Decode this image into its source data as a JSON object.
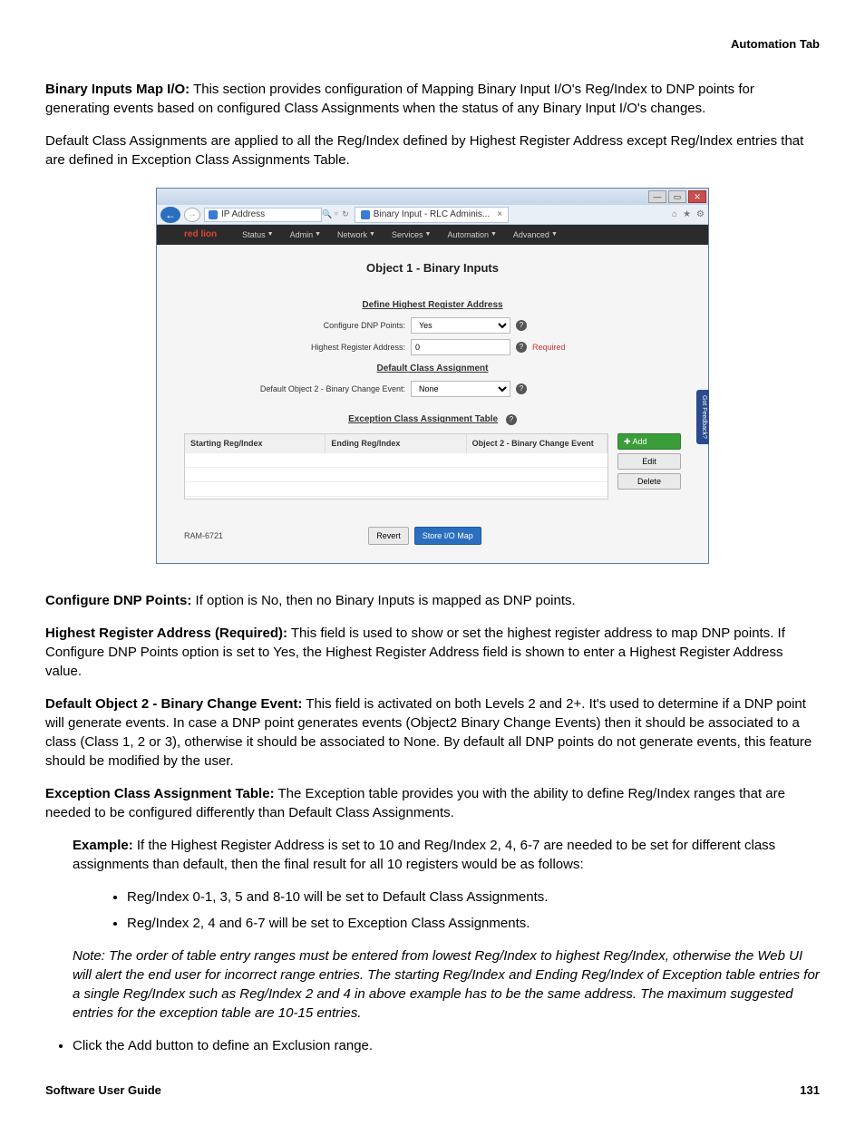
{
  "header": {
    "section": "Automation Tab"
  },
  "doc": {
    "p1_label": "Binary Inputs Map I/O:",
    "p1_text": " This section provides configuration of Mapping Binary Input I/O's Reg/Index to DNP points for generating events based on configured Class Assignments when the status of any Binary Input I/O's changes.",
    "p2": "Default Class Assignments are applied to all the Reg/Index defined by Highest Register Address except Reg/Index entries that are defined in Exception Class Assignments Table.",
    "cfg_label": "Configure DNP Points:",
    "cfg_text": " If option is No, then no Binary Inputs is mapped as DNP points.",
    "hra_label": "Highest Register Address (Required):",
    "hra_text": " This field is used to show or set the highest register address to map DNP points. If Configure DNP Points option is set to Yes, the Highest Register Address field is shown to enter a Highest Register Address value.",
    "dce_label": "Default Object 2 - Binary Change Event:",
    "dce_text": " This field is activated on both Levels 2 and 2+. It's used to determine if a DNP point will generate events. In case a DNP point generates events (Object2 Binary Change Events) then it should be associated to a class (Class 1, 2 or 3), otherwise it should be associated to None. By default all DNP points do not generate events, this feature should be modified by the user.",
    "ect_label": "Exception Class Assignment Table:",
    "ect_text": " The Exception table provides you with the ability to define Reg/Index ranges that are needed to be configured differently than Default Class Assignments.",
    "example_label": "Example:",
    "example_text": " If the Highest Register Address is set to 10 and Reg/Index 2, 4, 6-7 are needed to be set for different class assignments than default, then the final result for all 10 registers would be as follows:",
    "bullet1": "Reg/Index 0-1, 3, 5 and 8-10 will be set to Default Class Assignments.",
    "bullet2": "Reg/Index 2, 4 and 6-7 will be set to Exception Class Assignments.",
    "note": "Note: The order of table entry ranges must be entered from lowest Reg/Index to highest Reg/Index, otherwise the Web UI will alert the end user for incorrect range entries. The starting Reg/Index and Ending Reg/Index of Exception table entries for a single Reg/Index such as Reg/Index 2 and 4 in above example has to be the same address. The maximum suggested entries for the exception table are 10-15 entries.",
    "last_bullet": "Click the Add button to define an Exclusion range."
  },
  "screenshot": {
    "address_placeholder": "IP Address",
    "tab_title": "Binary Input - RLC Adminis...",
    "logo": "red lion",
    "nav": {
      "status": "Status",
      "admin": "Admin",
      "network": "Network",
      "services": "Services",
      "automation": "Automation",
      "advanced": "Advanced"
    },
    "title": "Object 1 - Binary Inputs",
    "sec1": "Define Highest Register Address",
    "row1_label": "Configure DNP Points:",
    "row1_value": "Yes",
    "row2_label": "Highest Register Address:",
    "row2_value": "0",
    "row2_req": "Required",
    "sec2": "Default Class Assignment",
    "row3_label": "Default Object 2 - Binary Change Event:",
    "row3_value": "None",
    "sec3": "Exception Class Assignment Table",
    "col1": "Starting Reg/Index",
    "col2": "Ending Reg/Index",
    "col3": "Object 2 - Binary Change Event",
    "btn_add": "Add",
    "btn_edit": "Edit",
    "btn_delete": "Delete",
    "device": "RAM-6721",
    "btn_revert": "Revert",
    "btn_store": "Store I/O Map",
    "feedback": "Got Feedback?"
  },
  "footer": {
    "left": "Software User Guide",
    "right": "131"
  }
}
